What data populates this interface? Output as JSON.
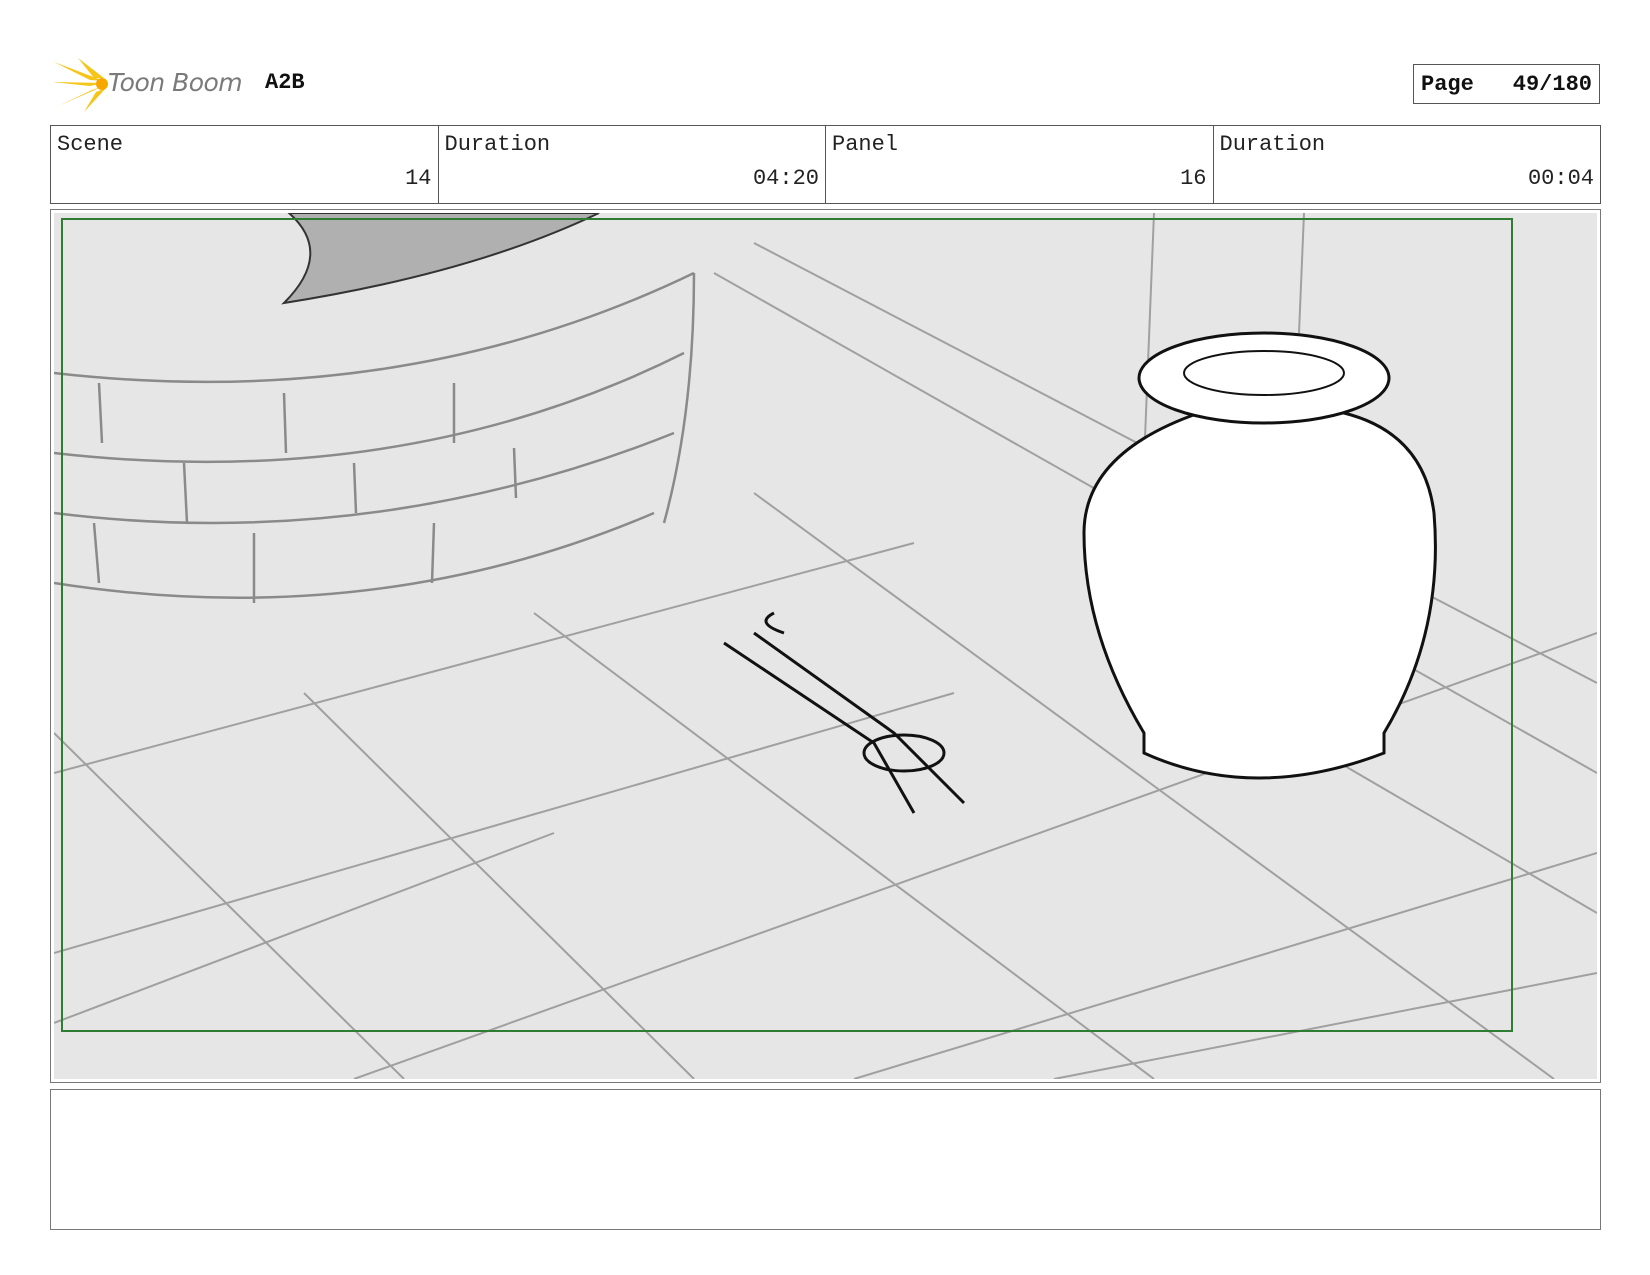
{
  "header": {
    "logo_text": "Toon Boom",
    "project": "A2B",
    "page_label": "Page",
    "page_number": "49/180"
  },
  "info": {
    "scene_label": "Scene",
    "scene_value": "14",
    "scene_duration_label": "Duration",
    "scene_duration_value": "04:20",
    "panel_label": "Panel",
    "panel_value": "16",
    "panel_duration_label": "Duration",
    "panel_duration_value": "00:04"
  },
  "colors": {
    "safe_frame": "#2e7d32",
    "logo_yellow": "#f5c518",
    "sketch_grey": "#999999"
  },
  "notes": {
    "text": ""
  }
}
